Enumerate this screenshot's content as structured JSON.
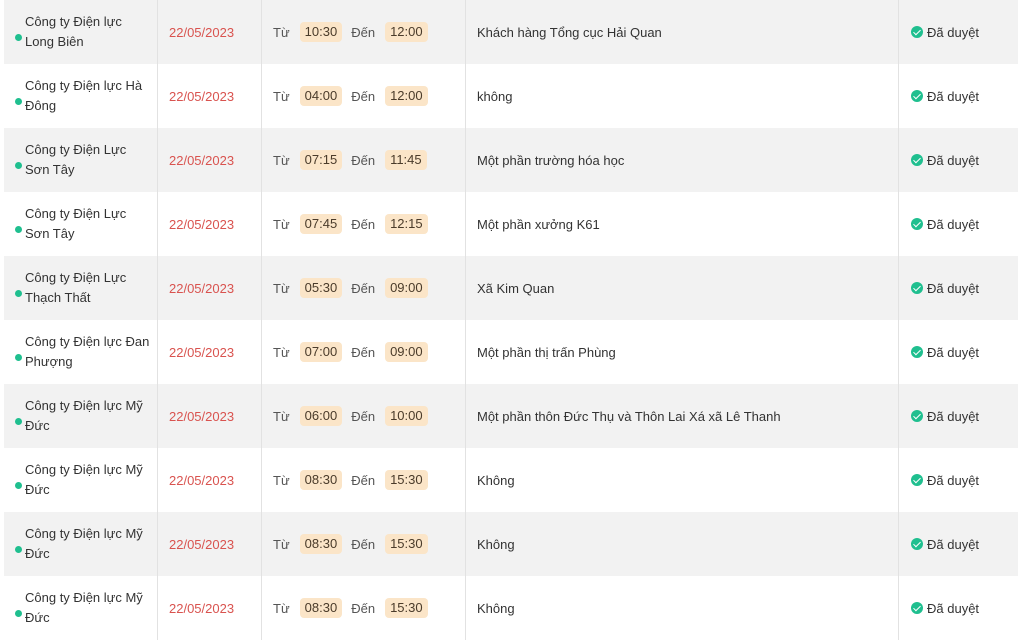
{
  "labels": {
    "from": "Từ",
    "to": "Đến"
  },
  "colors": {
    "date": "#d9534f",
    "status_icon": "#1fbf8f",
    "time_pill": "#fbe5c8"
  },
  "rows": [
    {
      "unit": "Công ty Điện lực Long Biên",
      "date": "22/05/2023",
      "from": "10:30",
      "to": "12:00",
      "area": "Khách hàng Tổng cục Hải Quan",
      "status": "Đã duyệt"
    },
    {
      "unit": "Công ty Điện lực Hà Đông",
      "date": "22/05/2023",
      "from": "04:00",
      "to": "12:00",
      "area": "không",
      "status": "Đã duyệt"
    },
    {
      "unit": "Công ty Điện Lực Sơn Tây",
      "date": "22/05/2023",
      "from": "07:15",
      "to": "11:45",
      "area": "Một phần trường hóa học",
      "status": "Đã duyệt"
    },
    {
      "unit": "Công ty Điện Lực Sơn Tây",
      "date": "22/05/2023",
      "from": "07:45",
      "to": "12:15",
      "area": "Một phần xưởng K61",
      "status": "Đã duyệt"
    },
    {
      "unit": "Công ty Điện Lực Thạch Thất",
      "date": "22/05/2023",
      "from": "05:30",
      "to": "09:00",
      "area": "Xã Kim Quan",
      "status": "Đã duyệt"
    },
    {
      "unit": "Công ty Điện lực Đan Phượng",
      "date": "22/05/2023",
      "from": "07:00",
      "to": "09:00",
      "area": "Một phần thị trấn Phùng",
      "status": "Đã duyệt"
    },
    {
      "unit": "Công ty Điện lực Mỹ Đức",
      "date": "22/05/2023",
      "from": "06:00",
      "to": "10:00",
      "area": "Một phần thôn Đức Thụ và Thôn Lai Xá xã Lê Thanh",
      "status": "Đã duyệt"
    },
    {
      "unit": "Công ty Điện lực Mỹ Đức",
      "date": "22/05/2023",
      "from": "08:30",
      "to": "15:30",
      "area": "Không",
      "status": "Đã duyệt"
    },
    {
      "unit": "Công ty Điện lực Mỹ Đức",
      "date": "22/05/2023",
      "from": "08:30",
      "to": "15:30",
      "area": "Không",
      "status": "Đã duyệt"
    },
    {
      "unit": "Công ty Điện lực Mỹ Đức",
      "date": "22/05/2023",
      "from": "08:30",
      "to": "15:30",
      "area": "Không",
      "status": "Đã duyệt"
    }
  ]
}
